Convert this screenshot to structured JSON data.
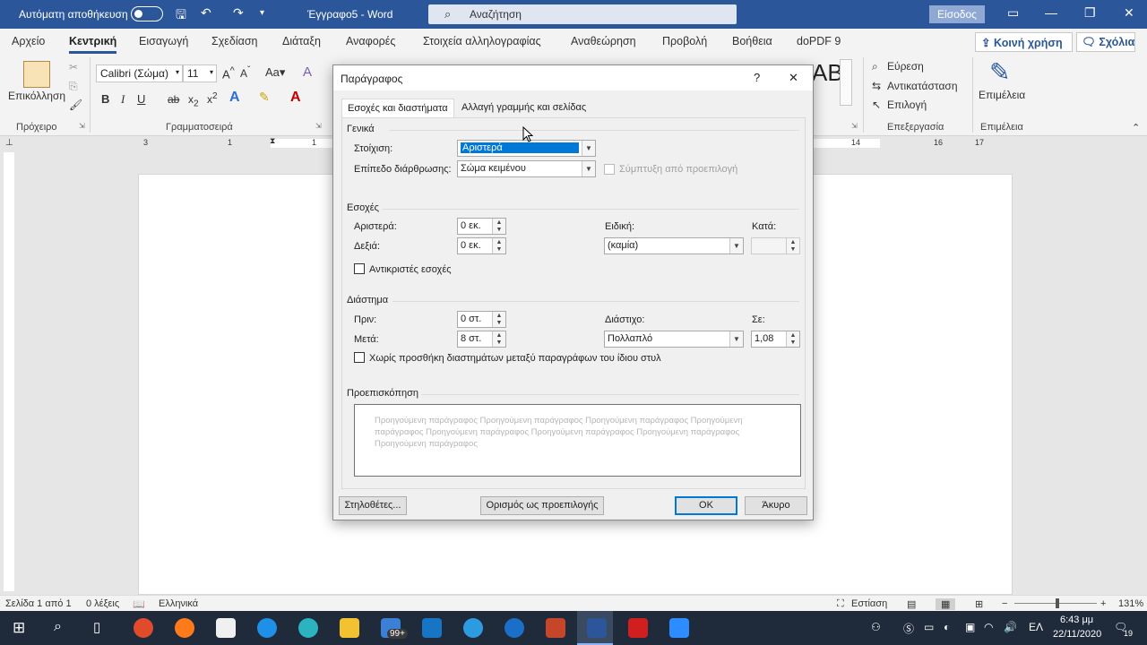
{
  "titlebar": {
    "autosave_label": "Αυτόματη αποθήκευση",
    "doc_title": "Έγγραφο5 - Word",
    "search_placeholder": "Αναζήτηση",
    "signin": "Είσοδος"
  },
  "tabs": [
    "Αρχείο",
    "Κεντρική",
    "Εισαγωγή",
    "Σχεδίαση",
    "Διάταξη",
    "Αναφορές",
    "Στοιχεία αλληλογραφίας",
    "Αναθεώρηση",
    "Προβολή",
    "Βοήθεια",
    "doPDF 9"
  ],
  "share_label": "Κοινή χρήση",
  "comments_label": "Σχόλια",
  "ribbon": {
    "paste": "Επικόλληση",
    "clipboard_group": "Πρόχειρο",
    "font_name": "Calibri (Σώμα)",
    "font_size": "11",
    "font_group": "Γραμματοσειρά",
    "find": "Εύρεση",
    "replace": "Αντικατάσταση",
    "select": "Επιλογή",
    "editing_group": "Επεξεργασία",
    "editor": "Επιμέλεια",
    "editor_group": "Επιμέλεια",
    "styles_glyph": "AB"
  },
  "ruler": {
    "left_numbers": [
      "3",
      "1",
      "1",
      "2",
      "1"
    ],
    "right_numbers": [
      "14",
      "15",
      "16",
      "17"
    ]
  },
  "status": {
    "page": "Σελίδα 1 από 1",
    "words": "0 λέξεις",
    "language": "Ελληνικά",
    "focus": "Εστίαση",
    "zoom": "131%"
  },
  "taskbar": {
    "time": "6:43 μμ",
    "date": "22/11/2020",
    "lang": "ΕΛ",
    "badge": "99+",
    "notif": "19"
  },
  "dialog": {
    "title": "Παράγραφος",
    "help": "?",
    "close": "✕",
    "tabs": [
      "Εσοχές και διαστήματα",
      "Αλλαγή γραμμής και σελίδας"
    ],
    "general": {
      "header": "Γενικά",
      "alignment_label": "Στοίχιση:",
      "alignment_value": "Αριστερά",
      "outline_label": "Επίπεδο διάρθρωσης:",
      "outline_value": "Σώμα κειμένου",
      "collapsed_label": "Σύμπτυξη από προεπιλογή"
    },
    "indent": {
      "header": "Εσοχές",
      "left_label": "Αριστερά:",
      "left_value": "0 εκ.",
      "right_label": "Δεξιά:",
      "right_value": "0 εκ.",
      "special_label": "Ειδική:",
      "special_value": "(καμία)",
      "by_label": "Κατά:",
      "by_value": "",
      "mirror_label": "Αντικριστές εσοχές"
    },
    "spacing": {
      "header": "Διάστημα",
      "before_label": "Πριν:",
      "before_value": "0 στ.",
      "after_label": "Μετά:",
      "after_value": "8 στ.",
      "line_label": "Διάστιχο:",
      "line_value": "Πολλαπλό",
      "at_label": "Σε:",
      "at_value": "1,08",
      "no_space_label": "Χωρίς προσθήκη διαστημάτων μεταξύ παραγράφων του ίδιου στυλ"
    },
    "preview": {
      "header": "Προεπισκόπηση",
      "lines": [
        "Προηγούμενη παράγραφος Προηγούμενη παράγραφος Προηγούμενη παράγραφος Προηγούμενη",
        "παράγραφος Προηγούμενη παράγραφος Προηγούμενη παράγραφος Προηγούμενη παράγραφος",
        "Προηγούμενη παράγραφος"
      ]
    },
    "buttons": {
      "tabs": "Στηλοθέτες...",
      "default": "Ορισμός ως προεπιλογής",
      "ok": "OK",
      "cancel": "Άκυρο"
    }
  },
  "colors": {
    "word_blue": "#2b579a",
    "selection": "#0078d7"
  }
}
